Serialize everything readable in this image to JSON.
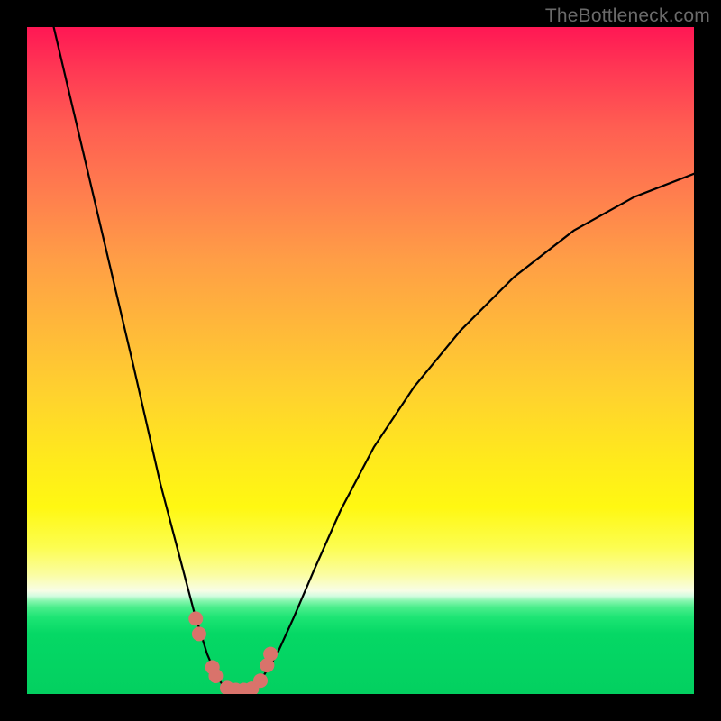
{
  "watermark": "TheBottleneck.com",
  "chart_data": {
    "type": "line",
    "title": "",
    "xlabel": "",
    "ylabel": "",
    "xlim": [
      0,
      1
    ],
    "ylim": [
      0,
      1
    ],
    "series": [
      {
        "name": "bottleneck-curve",
        "x": [
          0.04,
          0.08,
          0.12,
          0.16,
          0.2,
          0.225,
          0.25,
          0.27,
          0.285,
          0.3,
          0.315,
          0.33,
          0.35,
          0.375,
          0.4,
          0.43,
          0.47,
          0.52,
          0.58,
          0.65,
          0.73,
          0.82,
          0.91,
          1.0
        ],
        "y": [
          1.0,
          0.83,
          0.66,
          0.49,
          0.315,
          0.22,
          0.125,
          0.06,
          0.025,
          0.005,
          0.0,
          0.004,
          0.02,
          0.06,
          0.115,
          0.185,
          0.275,
          0.37,
          0.46,
          0.545,
          0.625,
          0.695,
          0.745,
          0.78
        ]
      }
    ],
    "markers": {
      "name": "highlight-dots",
      "color": "#d9736b",
      "x": [
        0.253,
        0.258,
        0.278,
        0.283,
        0.3,
        0.313,
        0.325,
        0.337,
        0.35,
        0.36,
        0.365
      ],
      "y": [
        0.113,
        0.09,
        0.04,
        0.027,
        0.009,
        0.006,
        0.006,
        0.008,
        0.02,
        0.043,
        0.06
      ]
    }
  }
}
